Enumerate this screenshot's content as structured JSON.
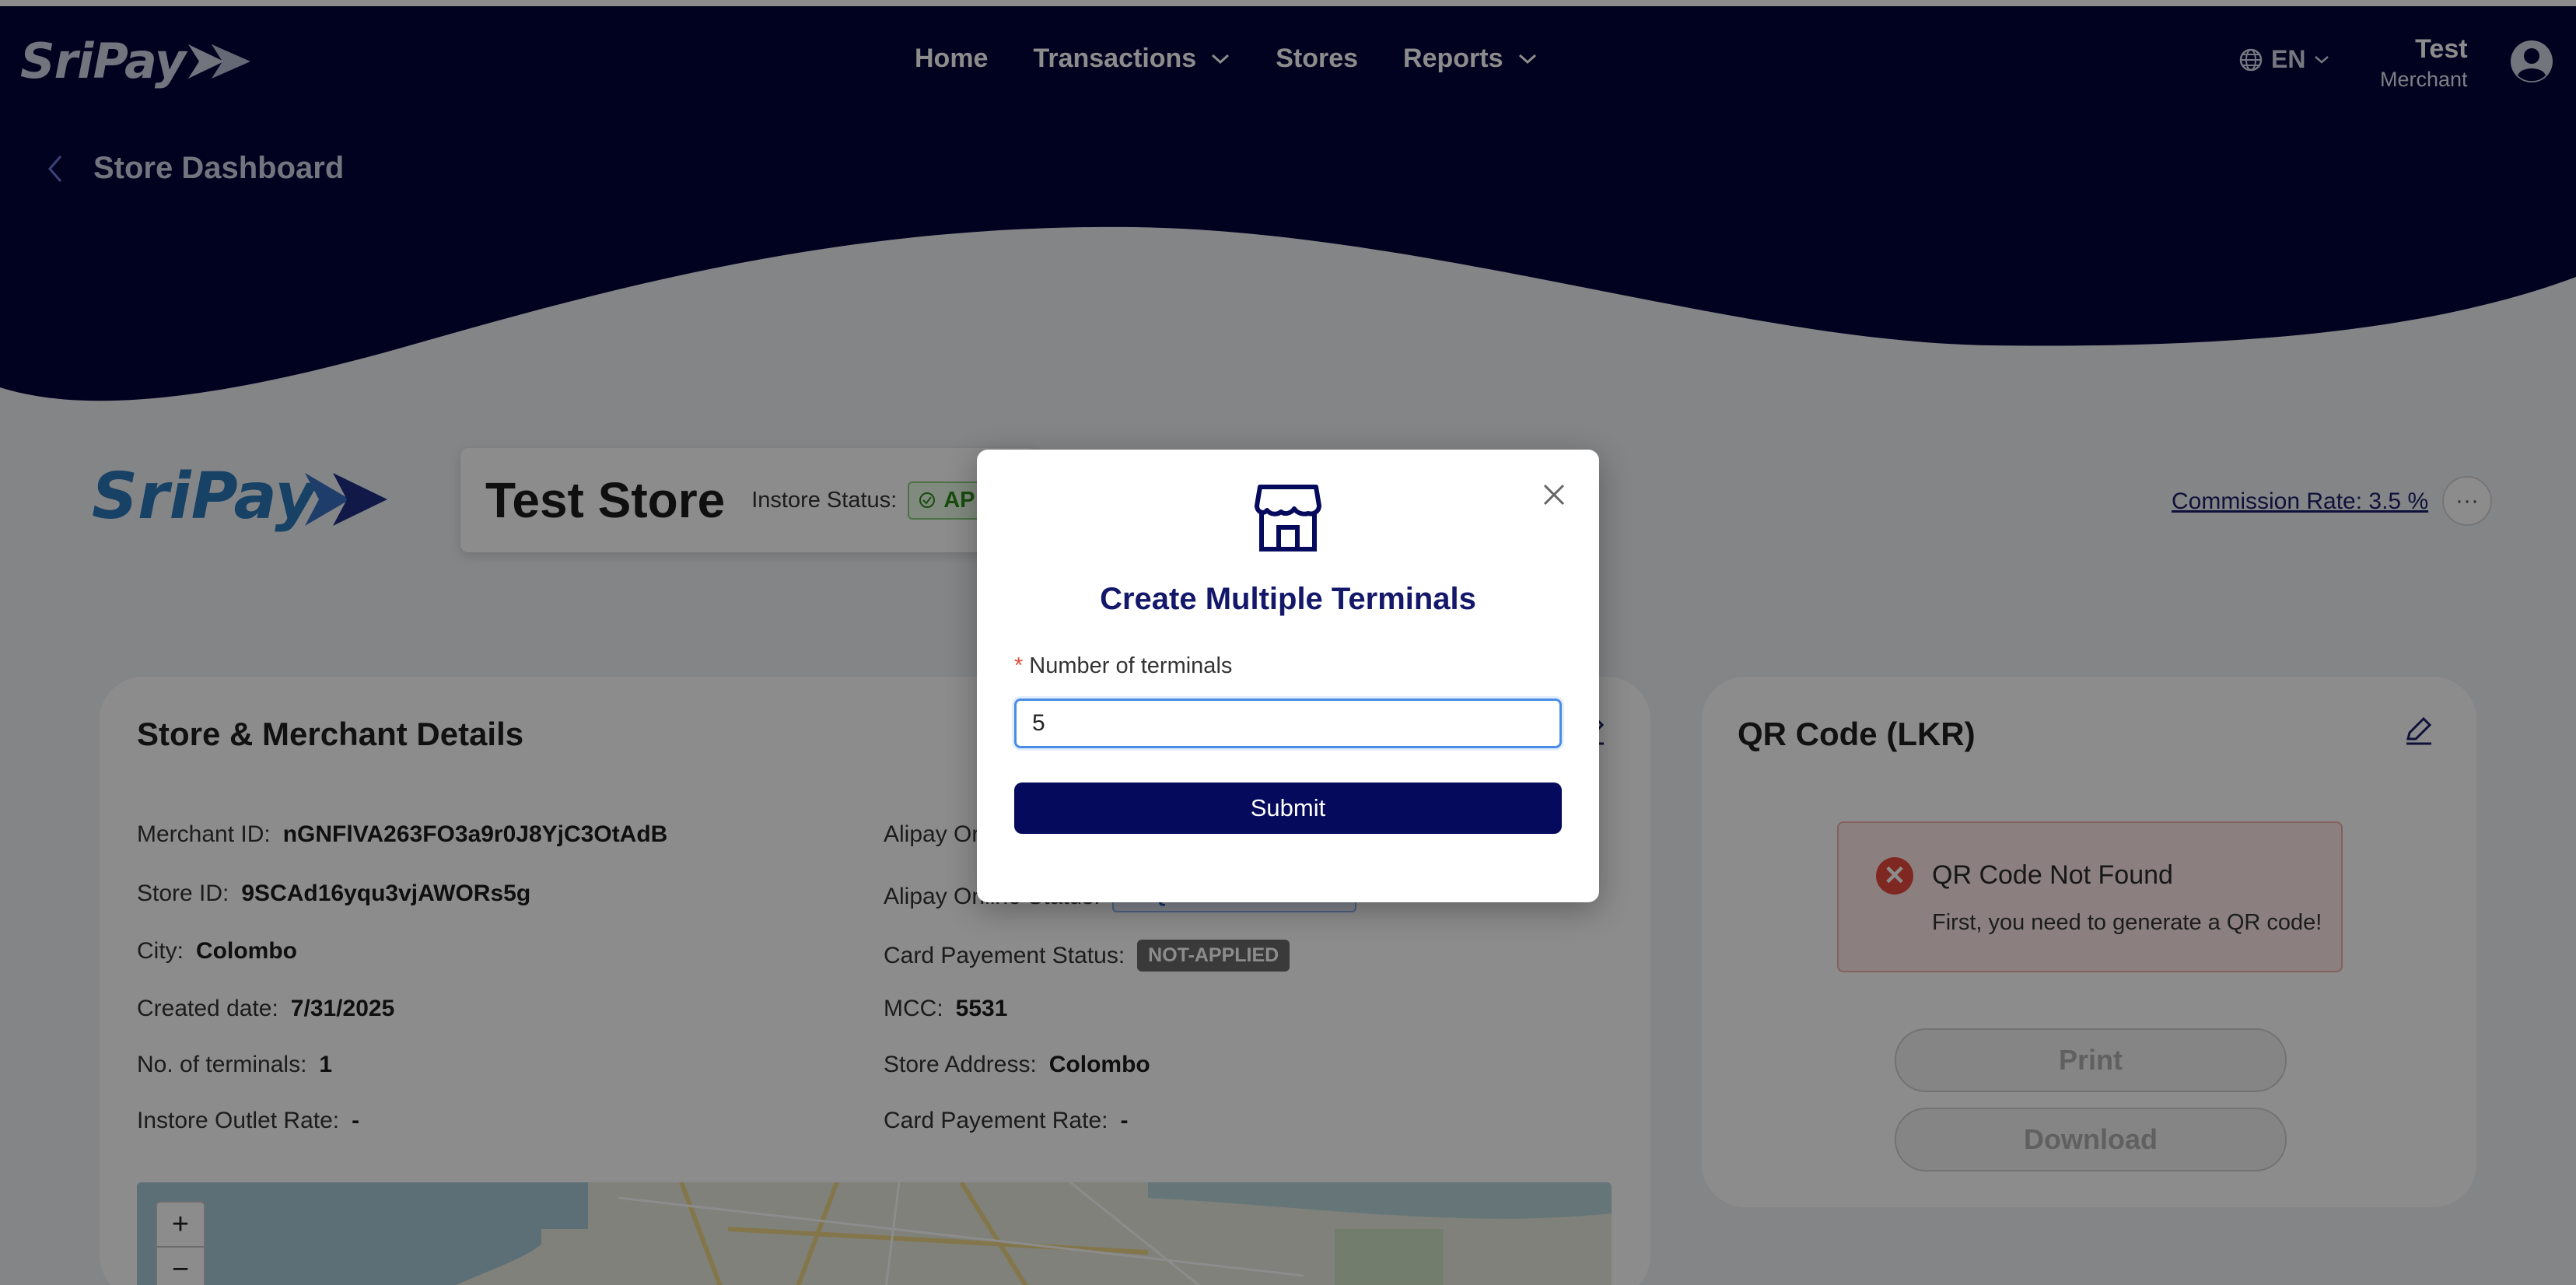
{
  "colors": {
    "navy": "#02033b",
    "accent": "#060a5c",
    "danger": "#e8493c",
    "success": "#2c8a1c"
  },
  "nav": {
    "logo": "SriPay",
    "items": [
      {
        "label": "Home",
        "dropdown": false
      },
      {
        "label": "Transactions",
        "dropdown": true
      },
      {
        "label": "Stores",
        "dropdown": false
      },
      {
        "label": "Reports",
        "dropdown": true
      }
    ],
    "language": "EN",
    "user_name": "Test",
    "user_role": "Merchant"
  },
  "page": {
    "title": "Store Dashboard"
  },
  "store": {
    "brand": "SriPay",
    "name": "Test Store",
    "instore_label": "Instore Status:",
    "instore_status": "AP",
    "commission": "Commission Rate: 3.5 %",
    "more_icon": "ellipsis-icon"
  },
  "details": {
    "title": "Store & Merchant Details",
    "left": [
      {
        "label": "Merchant ID:",
        "value": "nGNFlVA263FO3a9r0J8YjC3OtAdB"
      },
      {
        "label": "Store ID:",
        "value": "9SCAd16yqu3vjAWORs5g"
      },
      {
        "label": "City:",
        "value": "Colombo"
      },
      {
        "label": "Created date:",
        "value": "7/31/2025"
      },
      {
        "label": "No. of terminals:",
        "value": "1"
      },
      {
        "label": "Instore Outlet Rate:",
        "value": "-"
      }
    ],
    "right": {
      "alipay_online": "Alipay On",
      "alipay_status_label": "Alipay Online Status:",
      "alipay_status_value": "REQUEST IN PROCESS",
      "card_status_label": "Card Payement Status:",
      "card_status_value": "NOT-APPLIED",
      "mcc_label": "MCC:",
      "mcc_value": "5531",
      "address_label": "Store Address:",
      "address_value": "Colombo",
      "card_rate_label": "Card Payement Rate:",
      "card_rate_value": "-"
    },
    "map_zoom_in": "+",
    "map_zoom_out": "−"
  },
  "qr": {
    "title": "QR Code  (LKR)",
    "alert_title": "QR Code Not Found",
    "alert_desc": "First, you need to generate a QR code!",
    "print_label": "Print",
    "download_label": "Download"
  },
  "modal": {
    "title": "Create Multiple Terminals",
    "field_label": "Number of terminals",
    "field_value": "5",
    "submit_label": "Submit"
  }
}
